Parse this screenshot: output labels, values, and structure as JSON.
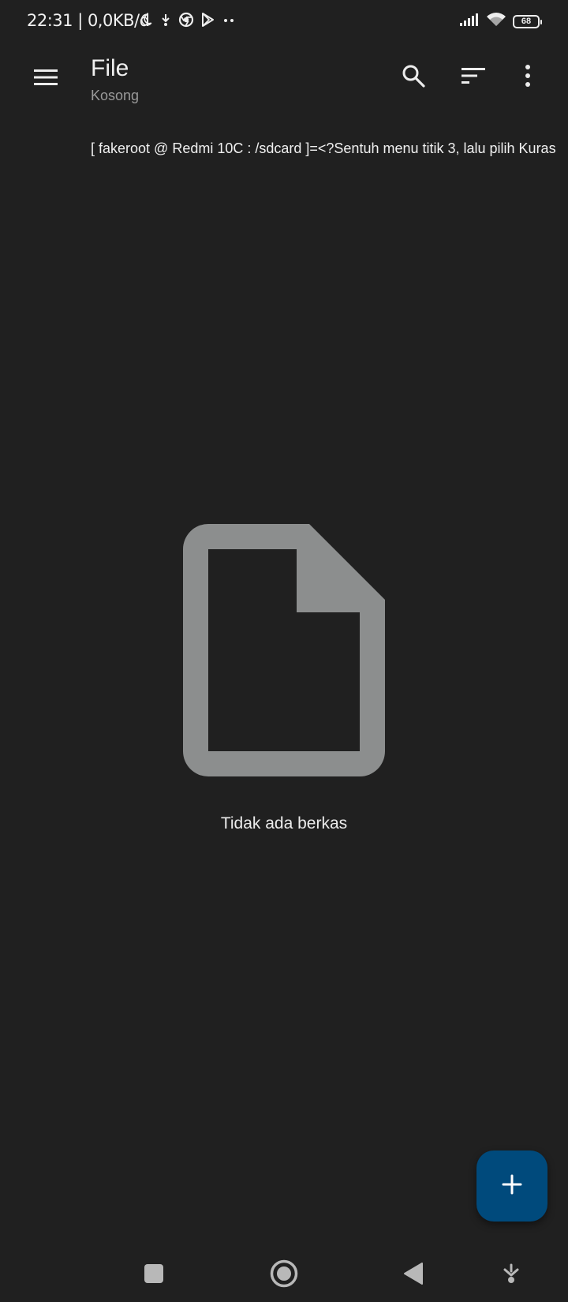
{
  "status_bar": {
    "time_text": "22:31 | 0,0KB/d",
    "battery_level": "68",
    "icons_left": [
      "moon-icon",
      "download-icon",
      "chrome-icon",
      "play-store-icon",
      "more-dots-icon"
    ],
    "icons_right": [
      "signal-icon",
      "wifi-icon",
      "battery-icon"
    ]
  },
  "app_bar": {
    "title": "File",
    "subtitle": "Kosong",
    "icons": [
      "menu-icon",
      "search-icon",
      "sort-icon",
      "more-vert-icon"
    ]
  },
  "path_bar": {
    "text": "[ fakeroot @ Redmi 10C : /sdcard ]=<?Sentuh menu titik 3, lalu pilih Kuras"
  },
  "empty_state": {
    "icon": "file-icon",
    "message": "Tidak ada berkas"
  },
  "fab": {
    "icon": "plus-icon",
    "color": "#004a7c"
  },
  "nav_bar": {
    "buttons": [
      "recents-icon",
      "home-icon",
      "back-icon",
      "collapse-icon"
    ]
  },
  "colors": {
    "background": "#202020",
    "text": "#ececec",
    "muted": "#9a9a9a",
    "icon_gray": "#8c8e8e"
  }
}
